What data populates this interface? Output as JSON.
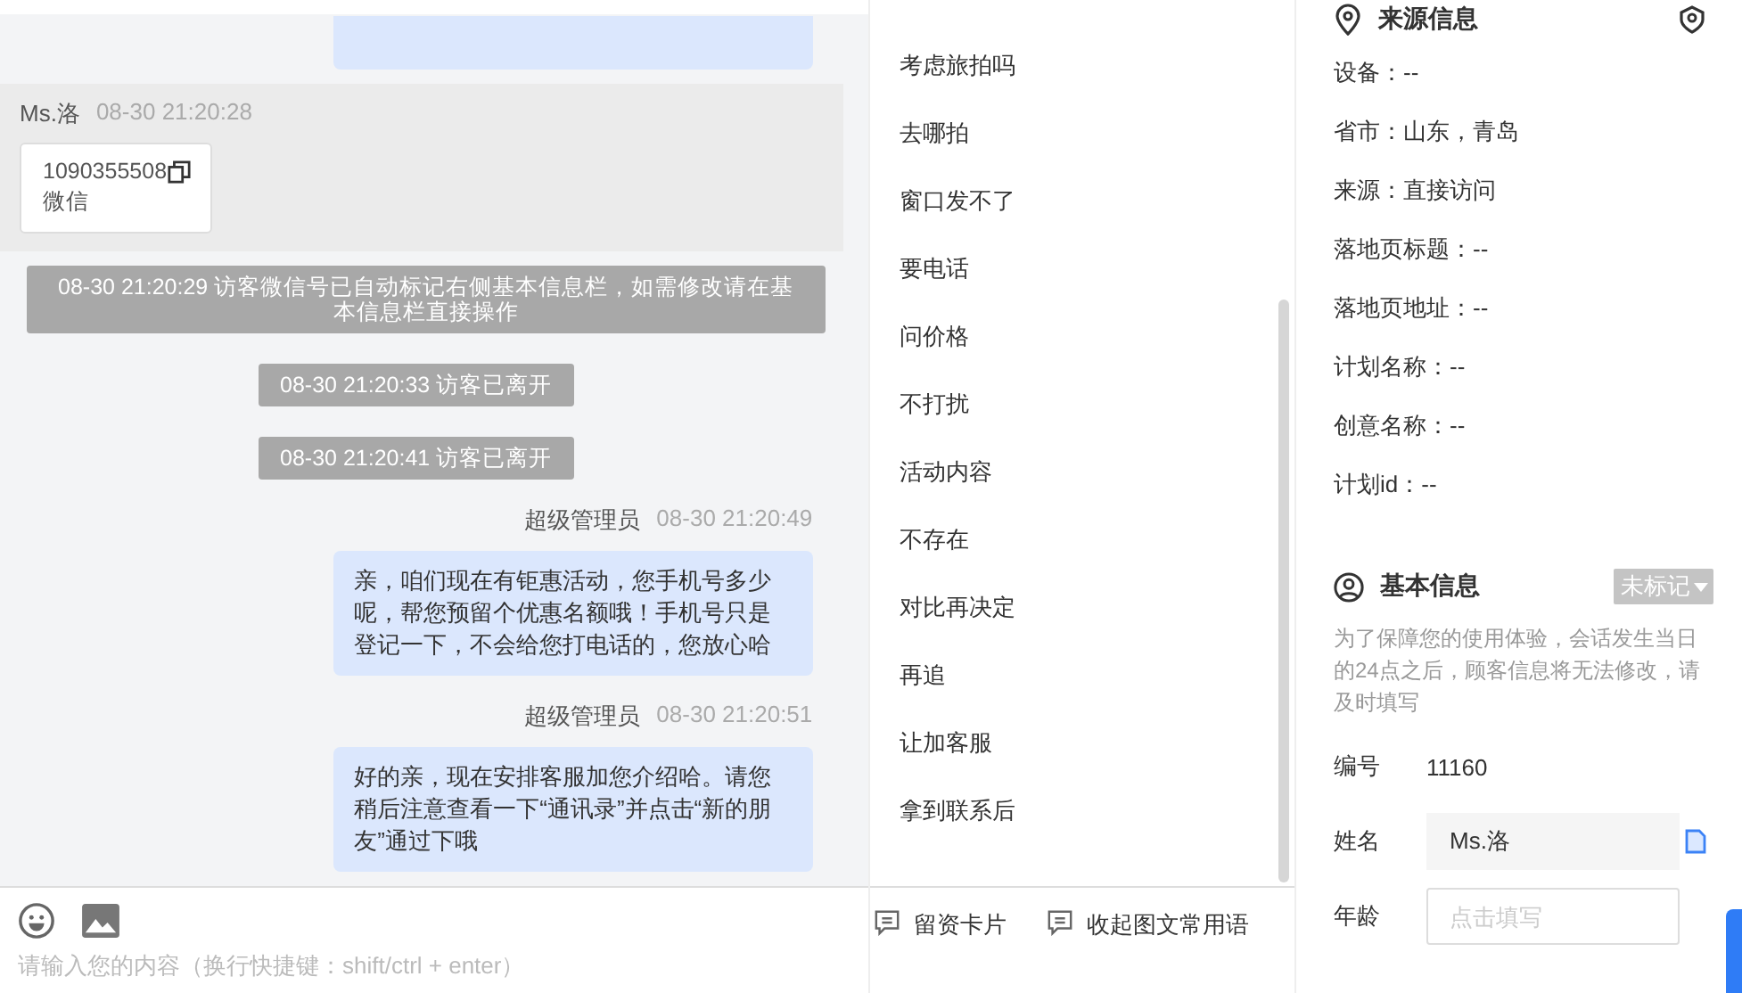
{
  "chat": {
    "messages": [
      {
        "kind": "outgoing_cut"
      },
      {
        "kind": "incoming",
        "sender": "Ms.洛",
        "time": "08-30 21:20:28",
        "card": {
          "value": "1090355508",
          "label": "微信"
        }
      },
      {
        "kind": "system",
        "wide": true,
        "text": "08-30 21:20:29 访客微信号已自动标记右侧基本信息栏，如需修改请在基本信息栏直接操作"
      },
      {
        "kind": "system",
        "wide": false,
        "text": "08-30 21:20:33 访客已离开"
      },
      {
        "kind": "system",
        "wide": false,
        "text": "08-30 21:20:41 访客已离开"
      },
      {
        "kind": "outgoing",
        "sender": "超级管理员",
        "time": "08-30 21:20:49",
        "text": "亲，咱们现在有钜惠活动，您手机号多少呢，帮您预留个优惠名额哦！手机号只是登记一下，不会给您打电话的，您放心哈"
      },
      {
        "kind": "outgoing",
        "sender": "超级管理员",
        "time": "08-30 21:20:51",
        "text": "好的亲，现在安排客服加您介绍哈。请您稍后注意查看一下“通讯录”并点击“新的朋友”通过下哦"
      }
    ],
    "input": {
      "placeholder": "请输入您的内容（换行快捷键：shift/ctrl + enter）"
    }
  },
  "quick_replies": {
    "items": [
      "考虑旅拍吗",
      "去哪拍",
      "窗口发不了",
      "要电话",
      "问价格",
      "不打扰",
      "活动内容",
      "不存在",
      "对比再决定",
      "再追",
      "让加客服",
      "拿到联系后"
    ],
    "actions": [
      "留资卡片",
      "收起图文常用语"
    ]
  },
  "source_info": {
    "title": "来源信息",
    "fields": [
      "设备：--",
      "省市：山东，青岛",
      "来源：直接访问",
      "落地页标题：--",
      "落地页地址：--",
      "计划名称：--",
      "创意名称：--",
      "计划id：--"
    ]
  },
  "basic_info": {
    "title": "基本信息",
    "tag": "未标记",
    "notice": "为了保障您的使用体验，会话发生当日的24点之后，顾客信息将无法修改，请及时填写",
    "fields": [
      {
        "kind": "text",
        "label": "编号",
        "value": "11160"
      },
      {
        "kind": "filled",
        "label": "姓名",
        "value": "Ms.洛"
      },
      {
        "kind": "input",
        "label": "年龄",
        "placeholder": "点击填写"
      }
    ]
  }
}
